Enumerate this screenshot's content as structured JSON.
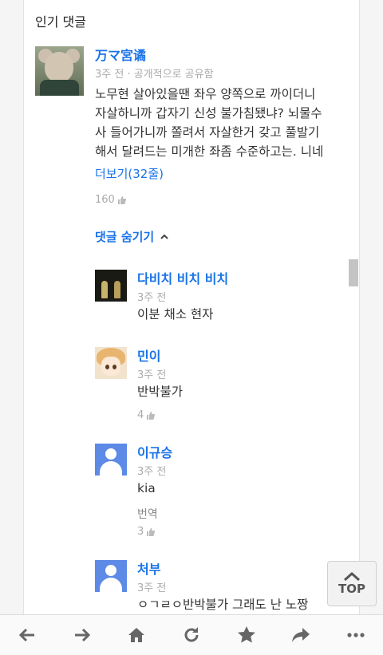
{
  "section_title": "인기 댓글",
  "top_comment": {
    "author": "万マ宮谲",
    "time": "3주 전",
    "visibility": "공개적으로 공유함",
    "lines": [
      "노무현 살아있을땐 좌우 양쪽으로 까이더니",
      "자살하니까 갑자기 신성 불가침됐냐? 뇌물수",
      "사 들어가니까 쫄려서 자살한거 갖고 풀발기",
      "해서 달려드는 미개한 좌좀 수준하고는. 니네"
    ],
    "more": "더보기(32줄)",
    "likes": "160"
  },
  "hide_replies_label": "댓글 숨기기",
  "replies": [
    {
      "author": "다비치 비치 비치",
      "time": "3주 전",
      "text": "이분 채소 현자",
      "likes": ""
    },
    {
      "author": "민이",
      "time": "3주 전",
      "text": "반박불가",
      "likes": "4"
    },
    {
      "author": "이규승",
      "time": "3주 전",
      "text": "kia",
      "translate": "번역",
      "likes": "3"
    },
    {
      "author": "처부",
      "time": "3주 전",
      "text": "ㅇㄱㄹㅇ반박불가 그래도 난 노짱"
    }
  ],
  "top_button": "TOP",
  "toolbar_icons": [
    "back-arrow-icon",
    "forward-arrow-icon",
    "home-icon",
    "reload-icon",
    "star-icon",
    "share-icon",
    "more-dots-icon"
  ],
  "colors": {
    "link": "#1a73e8",
    "meta": "#aaaaaa",
    "text": "#333333"
  }
}
